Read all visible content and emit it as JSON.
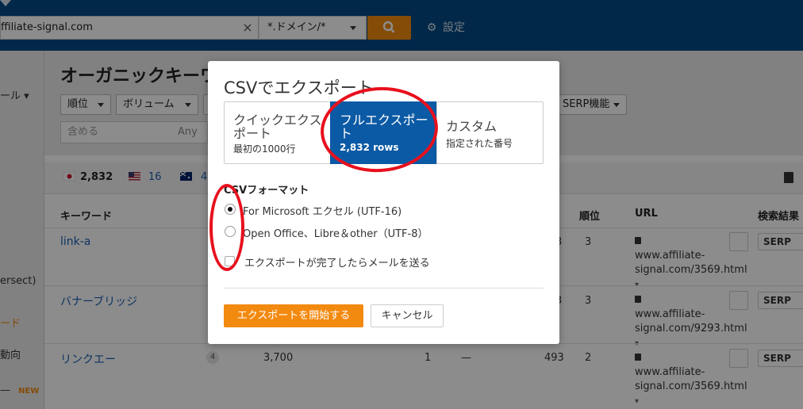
{
  "topbar": {
    "url_value": "ffiliate-signal.com",
    "clear_icon": "×",
    "mode_value": "*.ドメイン/*",
    "settings_label": "設定"
  },
  "sidebar": {
    "items": [
      {
        "label": "ール ▾"
      },
      {
        "label": "ersect)"
      },
      {
        "label": "ード"
      },
      {
        "label": "動向"
      },
      {
        "label": "—"
      }
    ],
    "new_badge": "NEW"
  },
  "page": {
    "title": "オーガニックキーワ",
    "filters": [
      "順位",
      "ボリューム",
      "SERP機能"
    ],
    "include_placeholder": "含める",
    "any_label": "Any"
  },
  "countries": [
    {
      "count": "2,832"
    },
    {
      "count": "16"
    },
    {
      "count": "4"
    }
  ],
  "table": {
    "headers": {
      "keyword": "キーワード",
      "rank": "順位",
      "url": "URL",
      "serp_result": "検索結果"
    },
    "rows": [
      {
        "keyword": "link-a",
        "position": "3",
        "rank": "3",
        "url": "www.affiliate-signal.com/3569.html"
      },
      {
        "keyword": "バナーブリッジ",
        "position": "3",
        "rank": "3",
        "url": "www.affiliate-signal.com/9293.html"
      },
      {
        "keyword": "リンクエー",
        "kd": "4",
        "volume": "3,700",
        "traffic": "1",
        "change": "—",
        "position": "493",
        "rank": "2",
        "url": "www.affiliate-signal.com/3569.html"
      }
    ],
    "serp_label": "SERP"
  },
  "modal": {
    "title": "CSVでエクスポート",
    "options": [
      {
        "label": "クイックエクスポート",
        "sub": "最初の1000行"
      },
      {
        "label": "フルエクスポート",
        "sub": "2,832 rows"
      },
      {
        "label": "カスタム",
        "sub": "指定された番号"
      }
    ],
    "format_label": "CSVフォーマット",
    "format_options": [
      {
        "label": "For Microsoft エクセル (UTF-16)",
        "selected": true
      },
      {
        "label": "Open Office、Libre＆other（UTF-8）",
        "selected": false
      }
    ],
    "email_checkbox_label": "エクスポートが完了したらメールを送る",
    "start_button": "エクスポートを開始する",
    "cancel_button": "キャンセル"
  },
  "colors": {
    "topbar": "#054a86",
    "accent": "#f38a10",
    "selected_option": "#0b5aa5",
    "annotation": "#e8101d",
    "link": "#1a5fb4"
  },
  "icons": [
    "search-icon",
    "gear-icon",
    "close-icon",
    "lock-icon",
    "chart-icon",
    "download-icon",
    "flag-jp-icon",
    "flag-us-icon",
    "flag-au-icon"
  ]
}
